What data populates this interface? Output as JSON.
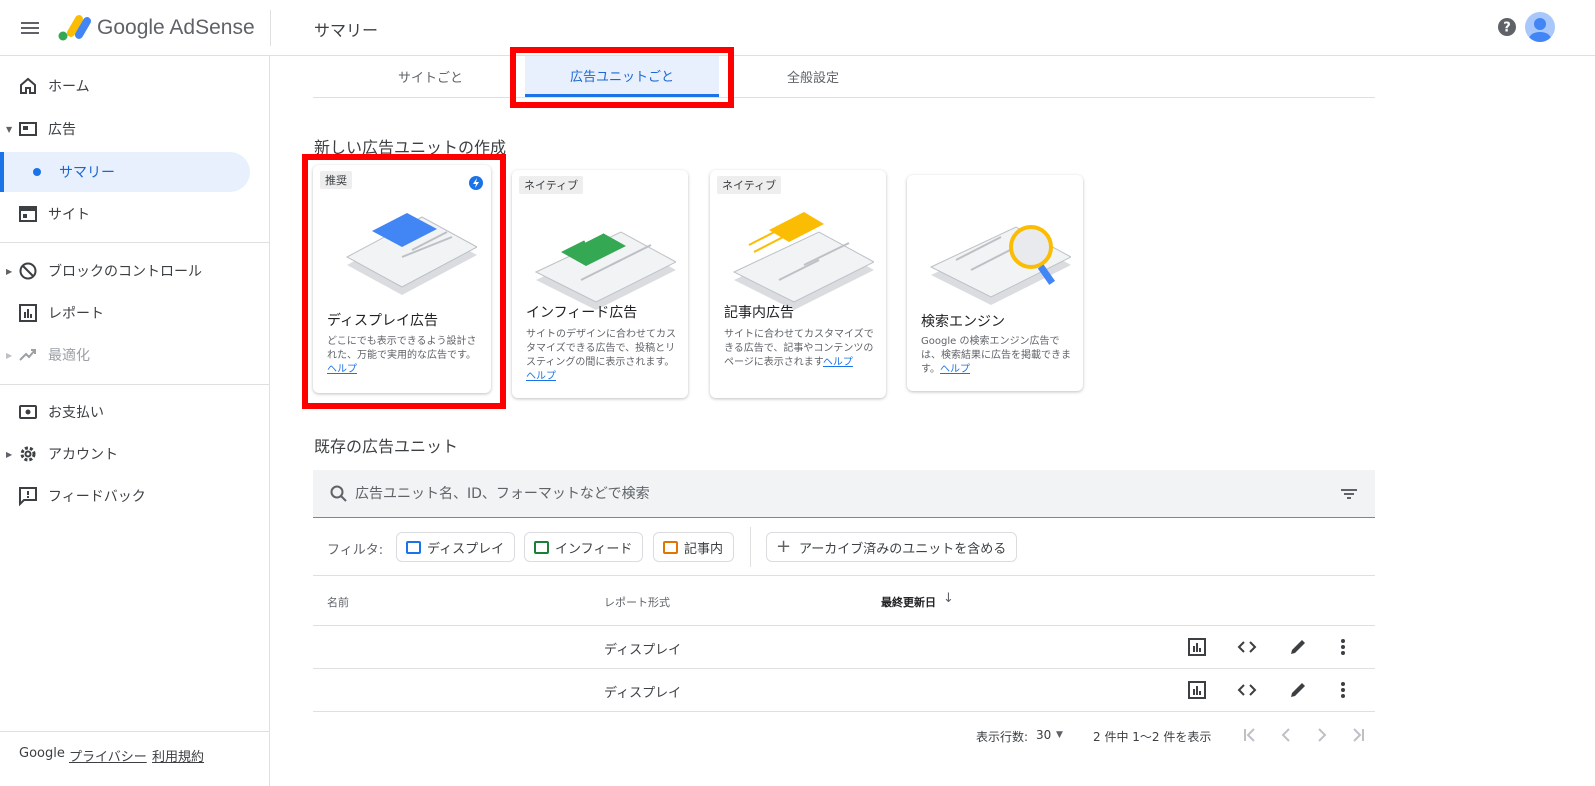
{
  "header": {
    "brand": "Google AdSense",
    "page_title": "サマリー"
  },
  "sidebar": {
    "items": [
      {
        "label": "ホーム"
      },
      {
        "label": "広告"
      },
      {
        "label": "サマリー"
      },
      {
        "label": "サイト"
      },
      {
        "label": "ブロックのコントロール"
      },
      {
        "label": "レポート"
      },
      {
        "label": "最適化"
      },
      {
        "label": "お支払い"
      },
      {
        "label": "アカウント"
      },
      {
        "label": "フィードバック"
      }
    ],
    "footer": {
      "google": "Google",
      "privacy": "プライバシー",
      "terms": "利用規約"
    }
  },
  "tabs": [
    {
      "label": "サイトごと"
    },
    {
      "label": "広告ユニットごと"
    },
    {
      "label": "全般設定"
    }
  ],
  "create_section": {
    "title": "新しい広告ユニットの作成"
  },
  "cards": [
    {
      "tag": "推奨",
      "title": "ディスプレイ広告",
      "desc": "どこにでも表示できるよう設計された、万能で実用的な広告です。",
      "help": "ヘルプ"
    },
    {
      "tag": "ネイティブ",
      "title": "インフィード広告",
      "desc": "サイトのデザインに合わせてカスタマイズできる広告で、投稿とリスティングの間に表示されます。",
      "help": "ヘルプ"
    },
    {
      "tag": "ネイティブ",
      "title": "記事内広告",
      "desc": "サイトに合わせてカスタマイズできる広告で、記事やコンテンツのページに表示されます",
      "help": "ヘルプ"
    },
    {
      "tag": "",
      "title": "検索エンジン",
      "desc": "Google の検索エンジン広告では、検索結果に広告を掲載できます。",
      "help": "ヘルプ"
    }
  ],
  "existing_section": {
    "title": "既存の広告ユニット"
  },
  "search": {
    "placeholder": "広告ユニット名、ID、フォーマットなどで検索"
  },
  "filters": {
    "label": "フィルタ:",
    "chips": [
      {
        "label": "ディスプレイ",
        "color": "#1a73e8"
      },
      {
        "label": "インフィード",
        "color": "#188038"
      },
      {
        "label": "記事内",
        "color": "#e37400"
      }
    ],
    "archive": "アーカイブ済みのユニットを含める"
  },
  "table": {
    "headers": {
      "name": "名前",
      "format": "レポート形式",
      "updated": "最終更新日",
      "sort_arrow": "↓"
    },
    "rows": [
      {
        "format": "ディスプレイ"
      },
      {
        "format": "ディスプレイ"
      }
    ]
  },
  "pagination": {
    "rows_label": "表示行数:",
    "rows_value": "30",
    "range": "2 件中 1〜2 件を表示"
  },
  "colors": {
    "accent": "#1a73e8",
    "highlight": "#ff0000"
  }
}
